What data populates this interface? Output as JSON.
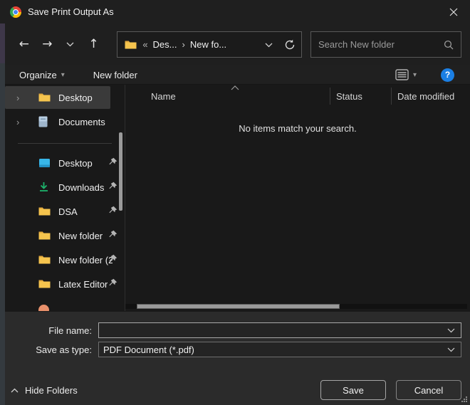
{
  "window": {
    "title": "Save Print Output As"
  },
  "navbar": {
    "breadcrumb": {
      "prefix": "«",
      "segment1": "Des...",
      "separator": "›",
      "segment2": "New fo..."
    },
    "search_placeholder": "Search New folder"
  },
  "toolbar": {
    "organize_label": "Organize",
    "new_folder_label": "New folder"
  },
  "sidebar": {
    "tree": [
      {
        "label": "Desktop",
        "icon": "folder",
        "selected": true
      },
      {
        "label": "Documents",
        "icon": "document",
        "selected": false
      }
    ],
    "pinned": [
      {
        "label": "Desktop",
        "icon": "desktop-monitor"
      },
      {
        "label": "Downloads",
        "icon": "downloads-arrow"
      },
      {
        "label": "DSA",
        "icon": "folder"
      },
      {
        "label": "New folder",
        "icon": "folder"
      },
      {
        "label": "New folder (2",
        "icon": "folder"
      },
      {
        "label": "Latex Editor",
        "icon": "folder"
      }
    ]
  },
  "list": {
    "columns": [
      "Name",
      "Status",
      "Date modified"
    ],
    "empty_message": "No items match your search."
  },
  "footer": {
    "file_name_label": "File name:",
    "file_name_value": "",
    "save_as_label": "Save as type:",
    "save_as_value": "PDF Document (*.pdf)",
    "save_label": "Save",
    "cancel_label": "Cancel",
    "hide_folders_label": "Hide Folders"
  },
  "colors": {
    "titlebar_bg": "#1f1f1f",
    "panel_bg": "#2b2b2b",
    "list_bg": "#191919",
    "folder_yellow": "#f5c44e",
    "downloads_green": "#1db26b",
    "desktop_blue": "#38b6e8",
    "help_blue": "#1b7fe4",
    "selection_gray": "#3a3a3a",
    "scrollbar_gray": "#9a9a9a"
  }
}
